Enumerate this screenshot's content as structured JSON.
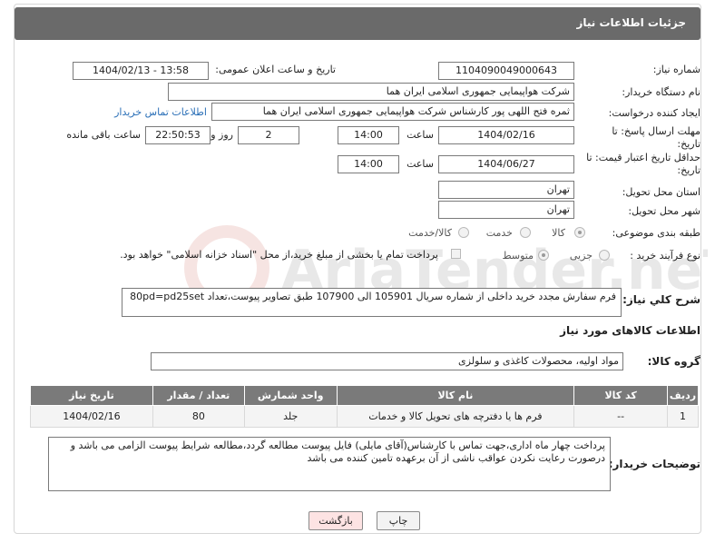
{
  "header": {
    "title": "جزئیات اطلاعات نیاز"
  },
  "labels": {
    "need_number": "شماره نیاز:",
    "announce_datetime": "تاریخ و ساعت اعلان عمومی:",
    "buyer_org": "نام دستگاه خریدار:",
    "requester": "ایجاد کننده درخواست:",
    "deadline_reply": "مهلت ارسال پاسخ: تا تاریخ:",
    "time_word": "ساعت",
    "day_and": "روز و",
    "time_remaining": "ساعت باقی مانده",
    "min_validity": "حداقل تاریخ اعتبار قیمت: تا تاریخ:",
    "delivery_province": "استان محل تحویل:",
    "delivery_city": "شهر محل تحویل:",
    "category": "طبقه بندی موضوعی:",
    "purchase_process": "نوع فرآیند خرید :",
    "general_desc": "شرح کلي نياز:",
    "goods_info": "اطلاعات کالاهای مورد نیاز",
    "goods_group": "گروه کالا:",
    "buyer_notes": "توضیحات خریدار:"
  },
  "values": {
    "need_number": "1104090049000643",
    "announce_datetime": "1404/02/13 - 13:58",
    "buyer_org": "شرکت هواپیمایی جمهوری اسلامی ایران هما",
    "requester": "ثمره فتح اللهی پور کارشناس شرکت هواپیمایی جمهوری اسلامی ایران هما",
    "contact_link": "اطلاعات تماس خریدار",
    "reply_date": "1404/02/16",
    "reply_time": "14:00",
    "reply_days": "2",
    "remaining_time": "22:50:53",
    "validity_date": "1404/06/27",
    "validity_time": "14:00",
    "province": "تهران",
    "city": "تهران",
    "general_desc": "فرم سفارش مجدد خرید داخلی از شماره سریال 105901 الی 107900 طبق تصاویر پیوست،تعداد 80pd=pd25set",
    "goods_group": "مواد اولیه، محصولات کاغذی و سلولزی",
    "buyer_notes": "پرداخت چهار ماه اداری،جهت تماس با کارشناس(آقای مایلی) فایل پیوست مطالعه گردد،مطالعه شرایط پیوست الزامی می باشد و درصورت رعایت نکردن عواقب ناشی از آن برعهده تامین کننده می باشد"
  },
  "category_options": {
    "goods": "کالا",
    "service": "خدمت",
    "goods_service": "کالا/خدمت",
    "selected": "کالا"
  },
  "process_options": {
    "minor": "جزیی",
    "medium": "متوسط",
    "selected": "متوسط",
    "payment_note": "پرداخت تمام یا بخشی از مبلغ خرید،از محل \"اسناد خزانه اسلامی\" خواهد بود."
  },
  "table": {
    "headers": [
      "ردیف",
      "کد کالا",
      "نام کالا",
      "واحد شمارش",
      "تعداد / مقدار",
      "تاریخ نیاز"
    ],
    "rows": [
      [
        "1",
        "--",
        "فرم ها یا دفترچه های تحویل کالا و خدمات",
        "جلد",
        "80",
        "1404/02/16"
      ]
    ]
  },
  "buttons": {
    "print": "چاپ",
    "back": "بازگشت"
  },
  "watermark": {
    "text": "AriaTender.neT"
  },
  "colors": {
    "header_bg": "#6a6a6a",
    "table_header_bg": "#7a7a7a",
    "link": "#2a6fb7",
    "back_button_bg": "#fde3e3"
  }
}
